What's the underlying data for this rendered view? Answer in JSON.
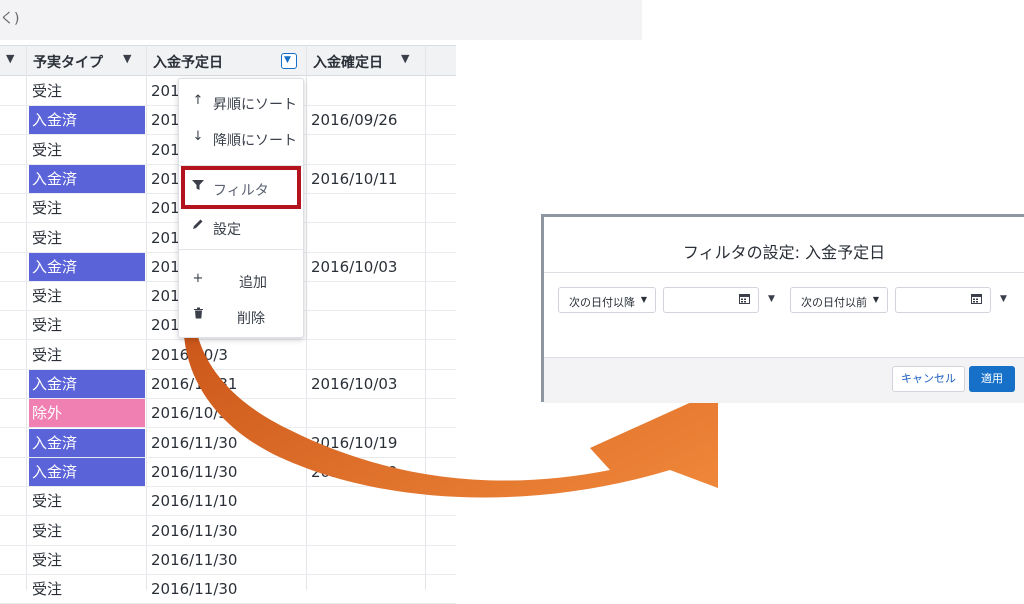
{
  "topbar": {
    "text": "く)"
  },
  "grid": {
    "headers": [
      {
        "label": ""
      },
      {
        "label": "予実タイプ"
      },
      {
        "label": "入金予定日"
      },
      {
        "label": "入金確定日"
      }
    ],
    "rows": [
      {
        "type": "受注",
        "style": "plain",
        "planned": "2016",
        "confirmed": ""
      },
      {
        "type": "入金済",
        "style": "blue",
        "planned": "2016",
        "confirmed": "2016/09/26"
      },
      {
        "type": "受注",
        "style": "plain",
        "planned": "2016",
        "confirmed": ""
      },
      {
        "type": "入金済",
        "style": "blue",
        "planned": "2016",
        "confirmed": "2016/10/11"
      },
      {
        "type": "受注",
        "style": "plain",
        "planned": "2016",
        "confirmed": ""
      },
      {
        "type": "受注",
        "style": "plain",
        "planned": "2016",
        "confirmed": ""
      },
      {
        "type": "入金済",
        "style": "blue",
        "planned": "2016",
        "confirmed": "2016/10/03"
      },
      {
        "type": "受注",
        "style": "plain",
        "planned": "2016",
        "confirmed": ""
      },
      {
        "type": "受注",
        "style": "plain",
        "planned": "2016",
        "confirmed": ""
      },
      {
        "type": "受注",
        "style": "plain",
        "planned": "2016/10/3",
        "confirmed": ""
      },
      {
        "type": "入金済",
        "style": "blue",
        "planned": "2016/10/31",
        "confirmed": "2016/10/03"
      },
      {
        "type": "除外",
        "style": "pink",
        "planned": "2016/10/31",
        "confirmed": ""
      },
      {
        "type": "入金済",
        "style": "blue",
        "planned": "2016/11/30",
        "confirmed": "2016/10/19"
      },
      {
        "type": "入金済",
        "style": "blue",
        "planned": "2016/11/30",
        "confirmed": "2016/10/19"
      },
      {
        "type": "受注",
        "style": "plain",
        "planned": "2016/11/10",
        "confirmed": ""
      },
      {
        "type": "受注",
        "style": "plain",
        "planned": "2016/11/30",
        "confirmed": ""
      },
      {
        "type": "受注",
        "style": "plain",
        "planned": "2016/11/30",
        "confirmed": ""
      },
      {
        "type": "受注",
        "style": "plain",
        "planned": "2016/11/30",
        "confirmed": ""
      }
    ]
  },
  "menu": {
    "items": [
      {
        "label": "昇順にソート",
        "icon": "arrow-up-icon"
      },
      {
        "label": "降順にソート",
        "icon": "arrow-down-icon"
      },
      {
        "label": "フィルタ",
        "icon": "filter-icon"
      },
      {
        "label": "設定",
        "icon": "pencil-icon"
      },
      {
        "label": "追加",
        "icon": "plus-icon"
      },
      {
        "label": "削除",
        "icon": "trash-icon"
      }
    ]
  },
  "dialog": {
    "title": "フィルタの設定: 入金予定日",
    "from_operator": "次の日付以降",
    "to_operator": "次の日付以前",
    "from_date": "",
    "to_date": "",
    "cancel_label": "キャンセル",
    "apply_label": "適用"
  },
  "colors": {
    "paid": "#5b63d8",
    "excluded": "#f07fb2",
    "highlight": "#b3131c",
    "arrow": "#e8762a",
    "primary": "#1670c8"
  }
}
